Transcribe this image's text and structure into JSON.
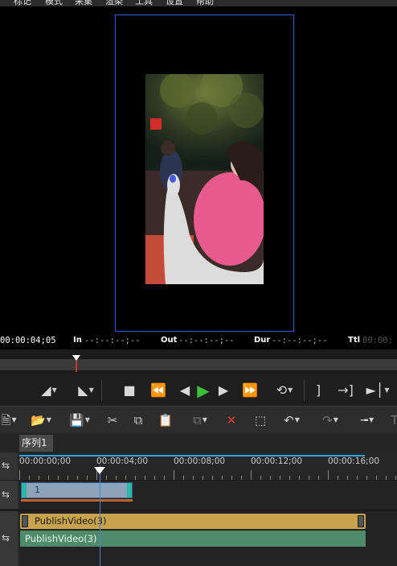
{
  "menu": [
    "标记",
    "模式",
    "采集",
    "渲染",
    "工具",
    "设置",
    "帮助"
  ],
  "timecode": {
    "current": "00:00:04;05",
    "in_label": "In",
    "in_value": "--:--:--;--",
    "out_label": "Out",
    "out_value": "--:--:--;--",
    "dur_label": "Dur",
    "dur_value": "--:--:--;--",
    "ttl_label": "Ttl",
    "ttl_value": "00:00:"
  },
  "sequence_tab": "序列1",
  "ruler_labels": [
    "00:00:00;00",
    "00:00:04;00",
    "00:00:08;00",
    "00:00:12;00",
    "00:00:16;00"
  ],
  "tracks": {
    "title_clip": "1",
    "video_clip": "PublishVideo(3)",
    "audio_clip": "PublishVideo(3)"
  },
  "colors": {
    "accent_blue": "#2a5bd7",
    "play_green": "#3bbf3b",
    "delete_red": "#e5412d",
    "video_clip": "#c8a24c",
    "audio_clip": "#4f8a6a",
    "title_clip": "#8fa3b8"
  },
  "icons": [
    "mark-in-icon",
    "mark-out-icon",
    "stop-icon",
    "rewind-icon",
    "step-back-icon",
    "play-icon",
    "step-forward-icon",
    "fast-forward-icon",
    "loop-icon",
    "go-to-in-icon",
    "go-to-out-icon",
    "in-out-icon",
    "new-icon",
    "open-icon",
    "save-icon",
    "cut-icon",
    "copy-icon",
    "paste-icon",
    "paste-special-icon",
    "delete-icon",
    "ripple-delete-icon",
    "undo-icon",
    "redo-icon",
    "set-mark-icon",
    "text-icon"
  ]
}
